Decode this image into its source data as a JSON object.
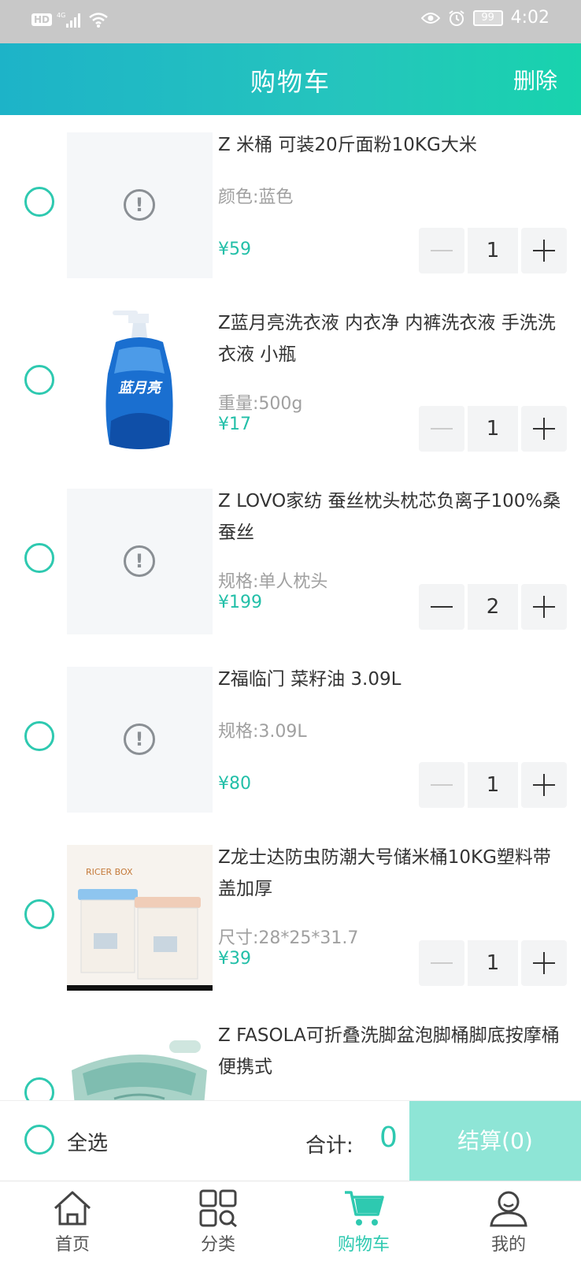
{
  "status_bar": {
    "network": "HD 4G",
    "battery": "99",
    "time": "4:02"
  },
  "header": {
    "title": "购物车",
    "delete_label": "删除"
  },
  "cart": {
    "items": [
      {
        "title": "Z 米桶 可装20斤面粉10KG大米",
        "spec": "颜色:蓝色",
        "price": "¥59",
        "quantity": "1",
        "image": "placeholder"
      },
      {
        "title": "Z蓝月亮洗衣液 内衣净 内裤洗衣液 手洗洗衣液 小瓶",
        "spec": "重量:500g",
        "price": "¥17",
        "quantity": "1",
        "image": "detergent-bottle",
        "image_text": "蓝月亮"
      },
      {
        "title": "Z LOVO家纺 蚕丝枕头枕芯负离子100%桑蚕丝",
        "spec": "规格:单人枕头",
        "price": "¥199",
        "quantity": "2",
        "image": "placeholder"
      },
      {
        "title": "Z福临门 菜籽油 3.09L",
        "spec": "规格:3.09L",
        "price": "¥80",
        "quantity": "1",
        "image": "placeholder"
      },
      {
        "title": "Z龙士达防虫防潮大号储米桶10KG塑料带盖加厚",
        "spec": "尺寸:28*25*31.7",
        "price": "¥39",
        "quantity": "1",
        "image": "rice-bins",
        "image_text": "RICER BOX"
      },
      {
        "title": "Z FASOLA可折叠洗脚盆泡脚桶脚底按摩桶便携式",
        "spec": "",
        "price": "",
        "quantity": "",
        "image": "foot-basin"
      }
    ]
  },
  "footer": {
    "select_all_label": "全选",
    "total_label": "合计:",
    "total_value": "0",
    "checkout_label": "结算(0)"
  },
  "tabs": [
    {
      "label": "首页",
      "icon": "home-icon",
      "active": false
    },
    {
      "label": "分类",
      "icon": "category-icon",
      "active": false
    },
    {
      "label": "购物车",
      "icon": "cart-icon",
      "active": true
    },
    {
      "label": "我的",
      "icon": "profile-icon",
      "active": false
    }
  ],
  "colors": {
    "accent": "#2ec9b0",
    "header_start": "#1db3c8",
    "header_end": "#18d3ad",
    "checkout_bg": "#8ee5d6",
    "status_bar": "#c8c8c8"
  }
}
